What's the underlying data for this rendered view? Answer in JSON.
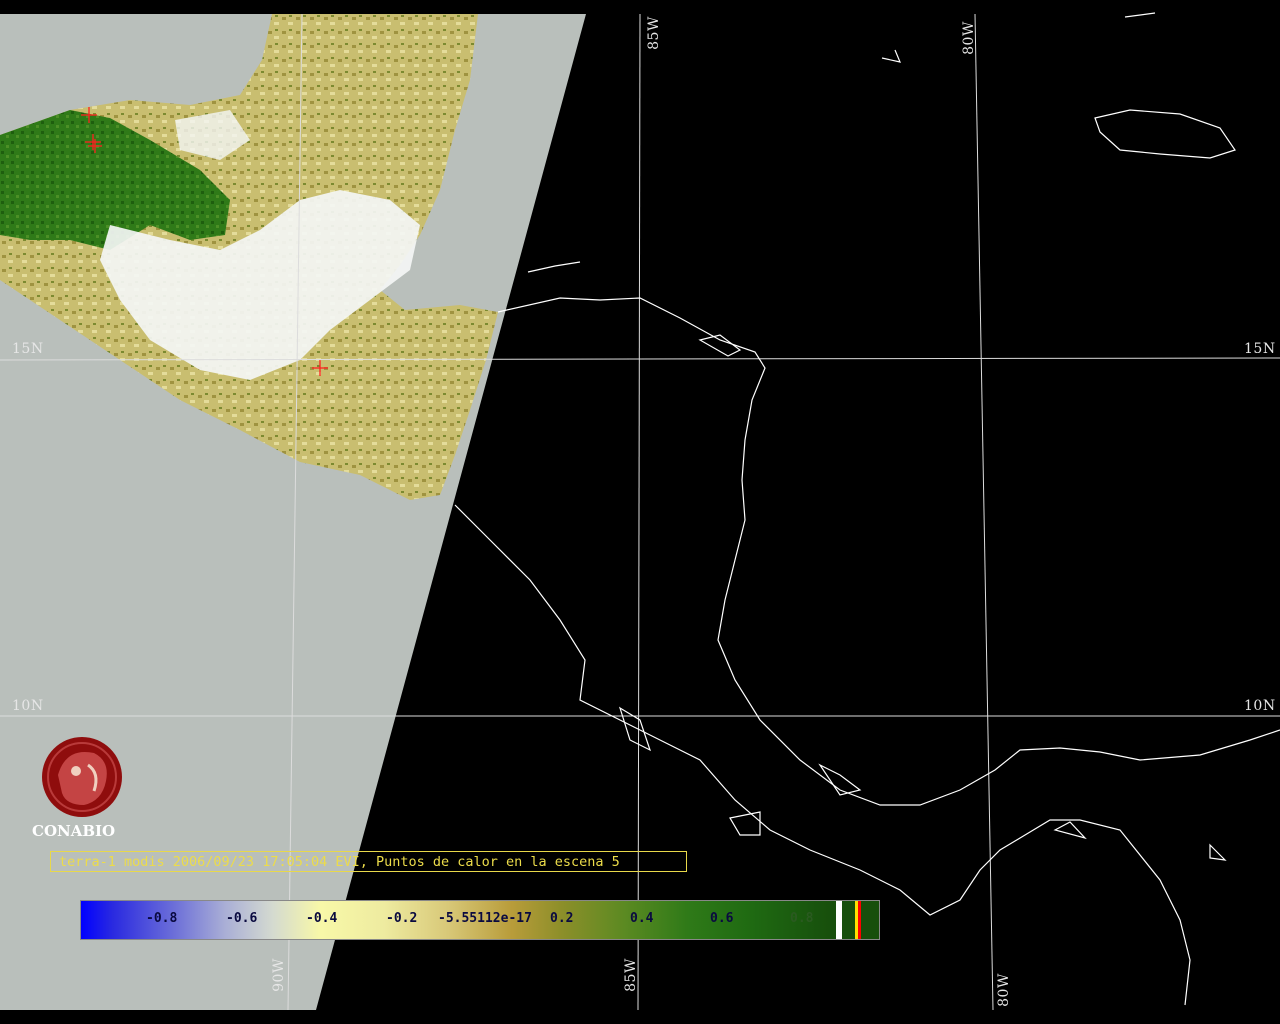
{
  "grid": {
    "lat_labels": [
      "15N",
      "15N",
      "10N",
      "10N"
    ],
    "lon_labels_top": [
      "85W",
      "80W"
    ],
    "lon_labels_bottom": [
      "90W",
      "85W",
      "80W"
    ]
  },
  "logo": {
    "name": "CONABIO",
    "icon": "conabio-macaw-logo-icon"
  },
  "caption": "terra-1 modis 2006/09/23 17:05:04 EVI, Puntos de calor en la escena 5",
  "colorbar": {
    "ticks": [
      "-0.8",
      "-0.6",
      "-0.4",
      "-0.2",
      "-5.55112e-17",
      "0.2",
      "0.4",
      "0.6",
      "0.8"
    ],
    "colors": {
      "min": "#0000ff",
      "mid": "#f8f8a8",
      "max": "#174f0c",
      "cloud": "#ffffff",
      "hotspot": "#ff0000"
    }
  },
  "hotspots_count": 5,
  "colors": {
    "no_data": "#b9bfbb",
    "background": "#000000",
    "coastline": "#ffffff",
    "hotspot_marker": "#ff2020"
  }
}
